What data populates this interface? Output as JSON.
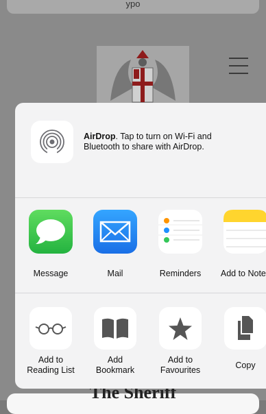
{
  "background_page": {
    "url_text": "ypo",
    "peek_title": "The Sheriff"
  },
  "airdrop": {
    "title": "AirDrop",
    "message": ". Tap to turn on Wi-Fi and Bluetooth to share with AirDrop.",
    "icon": "airdrop-icon"
  },
  "apps": [
    {
      "label": "Message",
      "icon": "messages-icon",
      "color": "#3cc94c"
    },
    {
      "label": "Mail",
      "icon": "mail-icon",
      "color": "#1e7cf1"
    },
    {
      "label": "Reminders",
      "icon": "reminders-icon",
      "color": "#ffffff"
    },
    {
      "label": "Add to Notes",
      "icon": "notes-icon",
      "color": "#ffd52e"
    }
  ],
  "actions": [
    {
      "label_line1": "Add to",
      "label_line2": "Reading List",
      "icon": "reading-list-icon"
    },
    {
      "label_line1": "Add",
      "label_line2": "Bookmark",
      "icon": "bookmark-icon"
    },
    {
      "label_line1": "Add to",
      "label_line2": "Favourites",
      "icon": "star-icon"
    },
    {
      "label_line1": "Copy",
      "label_line2": "",
      "icon": "copy-icon"
    }
  ]
}
